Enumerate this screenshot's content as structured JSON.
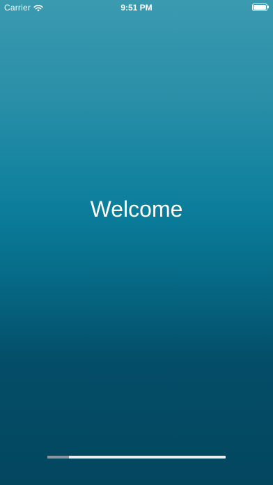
{
  "status_bar": {
    "carrier": "Carrier",
    "time": "9:51 PM",
    "wifi_icon": "wifi-icon",
    "battery_icon": "battery-icon"
  },
  "main": {
    "welcome_text": "Welcome"
  },
  "progress": {
    "value": 0.12
  },
  "colors": {
    "gradient_top": "#3a9ab0",
    "gradient_mid": "#0b7e9c",
    "gradient_bottom": "#03475f",
    "text": "#ffffff",
    "progress_track": "#e9eef1",
    "progress_fill": "#8a97a3"
  }
}
